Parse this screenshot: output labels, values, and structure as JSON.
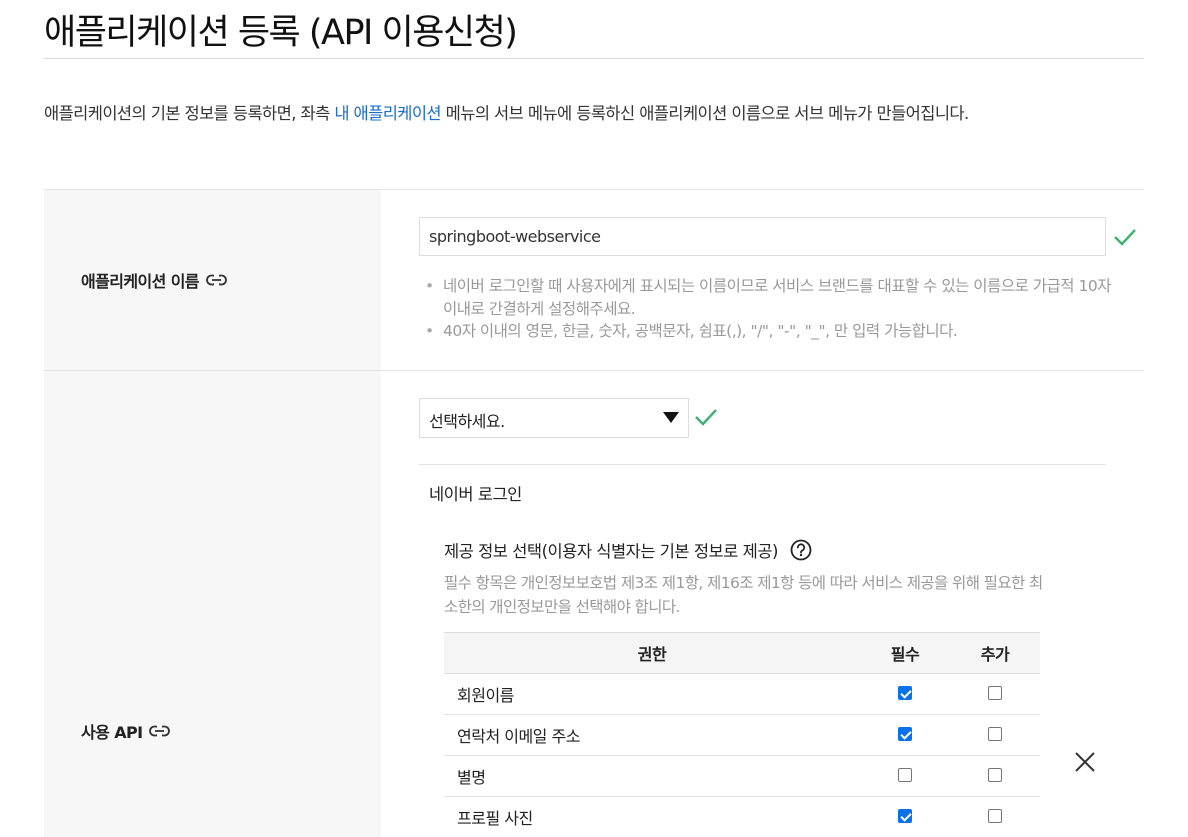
{
  "page": {
    "title": "애플리케이션 등록 (API 이용신청)",
    "intro_before": "애플리케이션의 기본 정보를 등록하면, 좌측 ",
    "intro_link": "내 애플리케이션",
    "intro_after": " 메뉴의 서브 메뉴에 등록하신 애플리케이션 이름으로 서브 메뉴가 만들어집니다."
  },
  "app_name": {
    "label": "애플리케이션 이름",
    "value": "springboot-webservice",
    "hints": [
      "네이버 로그인할 때 사용자에게 표시되는 이름이므로 서비스 브랜드를 대표할 수 있는 이름으로 가급적 10자 이내로 간결하게 설정해주세요.",
      "40자 이내의 영문, 한글, 숫자, 공백문자, 쉼표(,), \"/\", \"-\", \"_\", 만 입력 가능합니다."
    ]
  },
  "api": {
    "label": "사용 API",
    "select_value": "선택하세요.",
    "api_name": "네이버 로그인",
    "provision_title": "제공 정보 선택(이용자 식별자는 기본 정보로 제공)",
    "provision_desc": "필수 항목은 개인정보보호법 제3조 제1항, 제16조 제1항 등에 따라 서비스 제공을 위해 필요한 최소한의 개인정보만을 선택해야 합니다.",
    "table": {
      "headers": [
        "권한",
        "필수",
        "추가"
      ],
      "rows": [
        {
          "name": "회원이름",
          "required": true,
          "optional": false
        },
        {
          "name": "연락처 이메일 주소",
          "required": true,
          "optional": false
        },
        {
          "name": "별명",
          "required": false,
          "optional": false
        },
        {
          "name": "프로필 사진",
          "required": true,
          "optional": false
        }
      ]
    }
  },
  "icons": {
    "valid": "check-icon",
    "anchor": "link-icon",
    "help": "question-circle-icon",
    "remove": "close-icon"
  },
  "colors": {
    "link": "#1a6dc9",
    "valid_check": "#3cb371",
    "checkbox_checked": "#0a72e8"
  }
}
